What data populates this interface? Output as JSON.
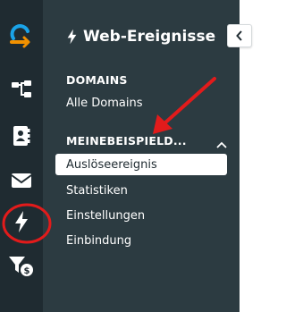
{
  "colors": {
    "rail_bg": "#1f2b31",
    "panel_bg": "#2c3b41",
    "brand_blue": "#1aa3e8",
    "brand_orange": "#f29100",
    "annotation_red": "#e21b1b",
    "active_item_bg": "#ffffff"
  },
  "rail": {
    "logo_icon": "brand-logo-icon",
    "items": [
      {
        "icon": "workflow-icon"
      },
      {
        "icon": "contacts-icon"
      },
      {
        "icon": "envelope-icon"
      },
      {
        "icon": "lightning-bolt-icon",
        "highlighted": true
      },
      {
        "icon": "funnel-dollar-icon"
      }
    ]
  },
  "panel": {
    "title": "Web-Ereignisse",
    "title_icon": "lightning-bolt-icon",
    "sections": [
      {
        "heading": "DOMAINS",
        "items": [
          "Alle Domains"
        ]
      },
      {
        "heading": "MEINEBEISPIELD...",
        "collapse_icon": "chevron-up-icon",
        "items": [
          "Auslöseereignis",
          "Statistiken",
          "Einstellungen",
          "Einbindung"
        ],
        "active_item": "Auslöseereignis"
      }
    ]
  },
  "collapse_button_icon": "chevron-left-icon"
}
